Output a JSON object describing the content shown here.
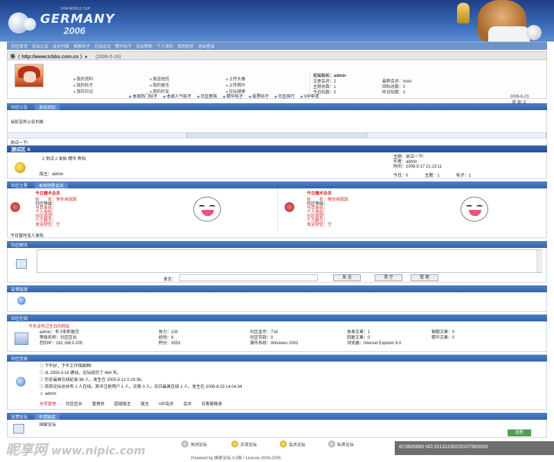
{
  "header": {
    "logo_tag": "FIFA WORLD CUP",
    "logo_title": "GERMANY",
    "logo_year": "2006"
  },
  "nav": [
    "社区首页",
    "论坛公告",
    "会员列表",
    "搜索帖子",
    "在线会员",
    "精华帖子",
    "论坛帮助",
    "个人资料",
    "我的短信",
    "退出登录"
  ],
  "url_bar": {
    "text": "等〈 http://www.tcbbs.com.cn 〉♦",
    "date": "(2006-5-16)"
  },
  "user_links": {
    "col1": [
      "我的资料",
      "我的帖子",
      "我的日记"
    ],
    "col2": [
      "发送短信",
      "我的留言",
      "我的好友"
    ],
    "col3": [
      "上传头像",
      "上传照片",
      "论坛搜索"
    ]
  },
  "stats": {
    "rows": [
      [
        "论坛站长：admin",
        ""
      ],
      [
        "注册会员：2",
        "最新会员：koko"
      ],
      [
        "主题总数：1",
        "回帖总数：0"
      ],
      [
        "今日帖数：0",
        "昨日帖数：0"
      ]
    ]
  },
  "date_side": {
    "date": "2006-6-23",
    "weekday": "星 期 五"
  },
  "tabs_row": [
    "本周热门帖子",
    "本周人气帖子",
    "社区新帖",
    "精华帖子",
    "投票帖子",
    "社区排行",
    "VIP申请"
  ],
  "announce_bar": {
    "left": "社区公告",
    "tab": "发帖须知"
  },
  "announce_text": "当前没有公告列表",
  "forum_title": "测试一下!",
  "section_a": {
    "title": "测试区 A"
  },
  "forum_row": {
    "desc": "2 测试 2 发贴 精华 新帖",
    "moderator": "版主：admin",
    "lastpost_title": "主题：测试一下!",
    "lastpost_author": "作者：admin",
    "lastpost_time": "时间：2006-5-17 21:13:11",
    "today": "今日：0",
    "topics": "主题：1",
    "posts": "帖子：1"
  },
  "star_bar": {
    "left": "社区之星",
    "tab": "本周明星会员"
  },
  "star_left": {
    "head": "今日魔术会员",
    "name": "姓　　名：等你来踩踩",
    "lines": [
      "社区等级：",
      "今日发帖：",
      "个人发帖：",
      "社区威望：",
      "个人魅力：",
      "发送短信：空"
    ]
  },
  "star_right": {
    "head": "今日魔术会员",
    "name": "姓　　名：等你来踩踩",
    "lines": [
      "社区等级：",
      "今日发帖：",
      "个人发帖：",
      "社区威望：",
      "个人魅力：",
      "发送短信：空"
    ]
  },
  "star_note": "今日暂时无人发帖",
  "chat_bar": "社区聊天",
  "chat": {
    "say_label": "发言：",
    "send": "发 送",
    "clear": "清 空",
    "manage": "管 理"
  },
  "links_bar": "友情链接",
  "online_bar": "社区在线",
  "online_head": "今天没有过生日的网友",
  "online": {
    "c1": [
      "admin：有 0条新留言",
      "等级名称：社区区长",
      "您的IP：192.168.0.205"
    ],
    "c2": [
      "体力：100",
      "经验：9",
      "积分：3553"
    ],
    "c3": [
      "社区金币：718",
      "社区存款：0",
      "操作系统：Windows 2003"
    ],
    "c4": [
      "发表文章：1",
      "回复文章：0",
      "浏览器：Internet Explorer 6.0"
    ],
    "c5": [
      "被删文章：0",
      "精华文章：0"
    ]
  },
  "info_bar": "社区信息",
  "info": {
    "greet": "下午好，下午工作恼跳啊!",
    "since": "从 2005-3-16 建站，论坛经历了 464 天。",
    "record": "历史最高在线纪录 98 人，发生在 2005-5-12 0:19:36。",
    "now": "目前论坛总共有 1 人在线。其中注册用户 1 人，访客 0 人。访日最高在线 1 人，发生在 2006-6-23 14:04:34",
    "user": "admin"
  },
  "legend": [
    "总单管理",
    "社区区长",
    "管理员",
    "超级版主",
    "版主",
    "VIP会员",
    "会员",
    "访客被隐身"
  ],
  "bottom_bar": {
    "left": "友情论坛",
    "tab": "申请链接"
  },
  "bottom_text": "国家论坛",
  "bottom_btn": "逛新",
  "footer_icons": [
    "关闭论坛",
    "正常论坛",
    "会员论坛",
    "私密论坛"
  ],
  "footer": "Powered by 国家论坛 V.3版 / License 2004-2005",
  "watermark": {
    "brand": "昵享网",
    "url": "www.nipic.com"
  },
  "id_bar": "ID:5605889 NO:20131230220107663000"
}
